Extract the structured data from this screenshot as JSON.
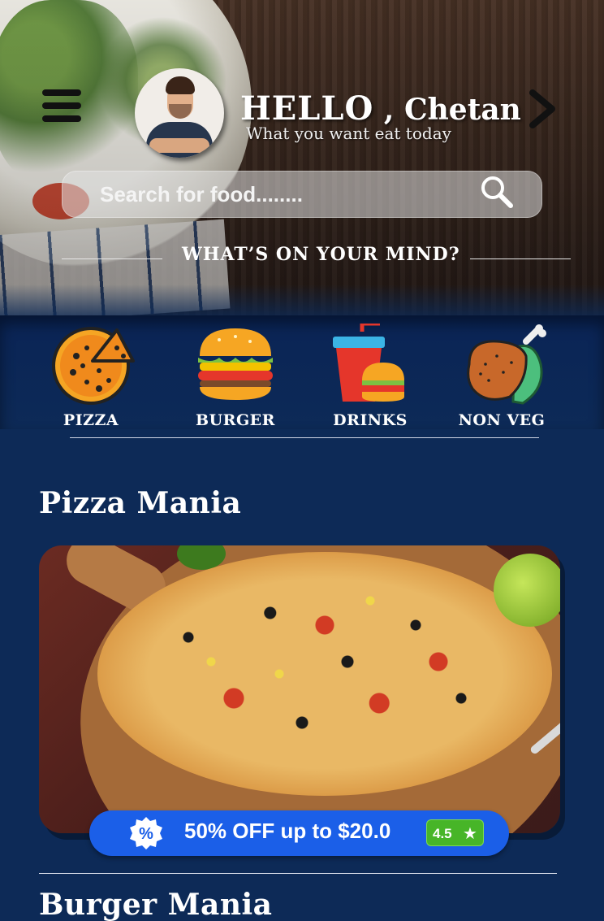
{
  "header": {
    "greeting_hello": "HELLO",
    "greeting_comma": " , ",
    "user_name": "Chetan",
    "subtitle": "What you want eat today"
  },
  "search": {
    "placeholder": "Search for food........"
  },
  "mind_section": {
    "title": "WHAT’S ON YOUR MIND?"
  },
  "categories": [
    {
      "label": "PIZZA",
      "icon": "pizza-icon"
    },
    {
      "label": "BURGER",
      "icon": "burger-icon"
    },
    {
      "label": "DRINKS",
      "icon": "drinks-icon"
    },
    {
      "label": "NON VEG",
      "icon": "chicken-leg-icon"
    }
  ],
  "sections": [
    {
      "title": "Pizza Mania",
      "offer_text": "50% OFF up to $20.0",
      "rating": "4.5"
    },
    {
      "title": "Burger Mania"
    }
  ],
  "colors": {
    "background": "#0d2a57",
    "offer_pill": "#1b5fe8",
    "rating_badge": "#47b528"
  }
}
